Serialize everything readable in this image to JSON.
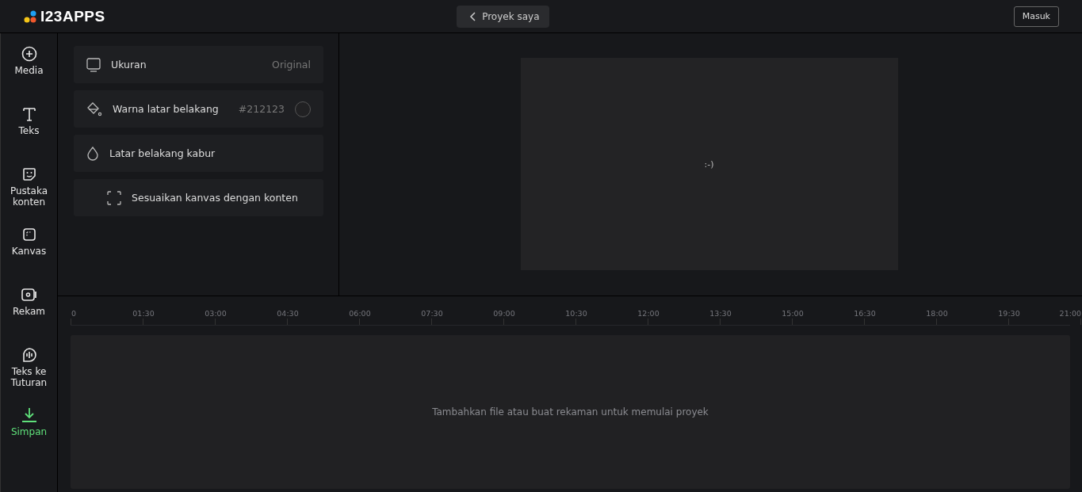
{
  "header": {
    "logo": "I23APPS",
    "back_button": "Proyek saya",
    "login_button": "Masuk"
  },
  "sidebar": {
    "items": [
      {
        "kind": "media",
        "label": "Media",
        "highlighted": false
      },
      {
        "kind": "text",
        "label": "Teks",
        "highlighted": false
      },
      {
        "kind": "library",
        "label": "Pustaka konten",
        "highlighted": false
      },
      {
        "kind": "canvas",
        "label": "Kanvas",
        "highlighted": false
      },
      {
        "kind": "record",
        "label": "Rekam",
        "highlighted": false
      },
      {
        "kind": "speech",
        "label": "Teks ke Tuturan",
        "highlighted": false
      },
      {
        "kind": "save",
        "label": "Simpan",
        "highlighted": true
      }
    ]
  },
  "settings": [
    {
      "kind": "size",
      "label": "Ukuran",
      "value": "Original"
    },
    {
      "kind": "color",
      "label": "Warna latar belakang",
      "value": "#212123",
      "color": "#212123"
    },
    {
      "kind": "blur",
      "label": "Latar belakang kabur"
    },
    {
      "kind": "fit",
      "label": "Sesuaikan kanvas dengan konten"
    }
  ],
  "preview": {
    "text": ":-)"
  },
  "timeline": {
    "ticks": [
      "0",
      "01:30",
      "03:00",
      "04:30",
      "06:00",
      "07:30",
      "09:00",
      "10:30",
      "12:00",
      "13:30",
      "15:00",
      "16:30",
      "18:00",
      "19:30",
      "21:00"
    ],
    "empty_message": "Tambahkan file atau buat rekaman untuk memulai proyek"
  }
}
